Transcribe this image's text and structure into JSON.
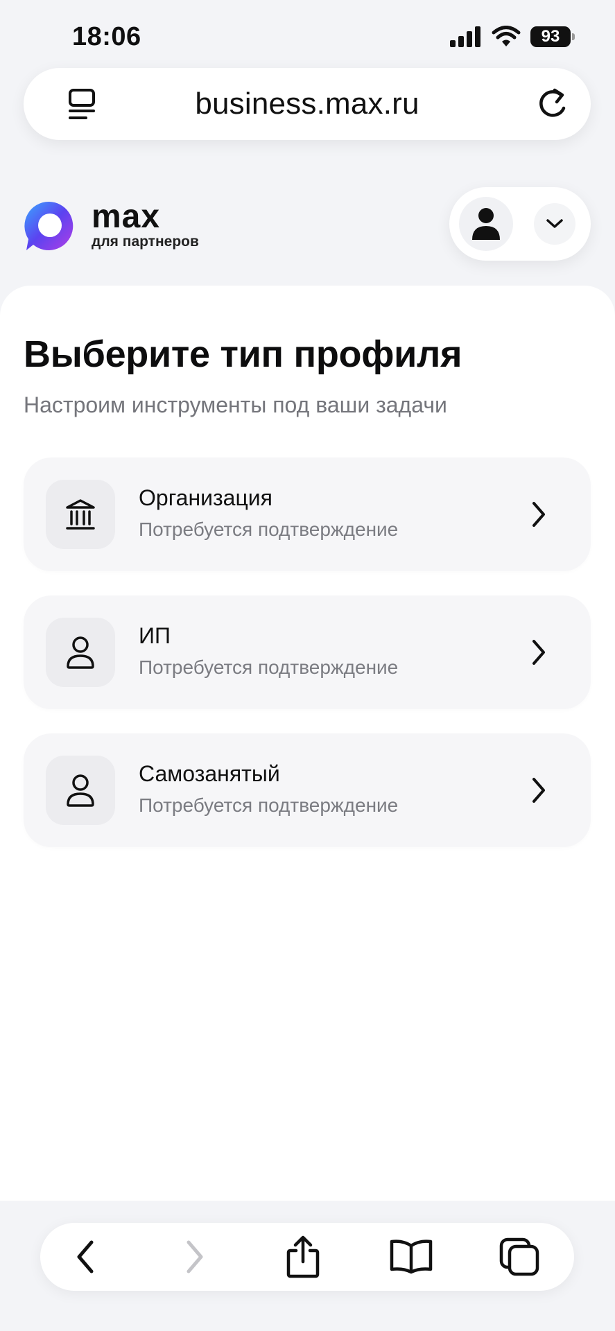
{
  "status_bar": {
    "time": "18:06",
    "battery": "93"
  },
  "browser": {
    "url": "business.max.ru"
  },
  "brand": {
    "name": "max",
    "subtitle": "для партнеров"
  },
  "page": {
    "title": "Выберите тип профиля",
    "subtitle": "Настроим инструменты под ваши задачи"
  },
  "options": [
    {
      "title": "Организация",
      "description": "Потребуется подтверждение",
      "icon": "bank-icon"
    },
    {
      "title": "ИП",
      "description": "Потребуется подтверждение",
      "icon": "person-icon"
    },
    {
      "title": "Самозанятый",
      "description": "Потребуется подтверждение",
      "icon": "person-icon"
    }
  ],
  "colors": {
    "background": "#f3f4f7",
    "card": "#f6f6f8",
    "muted_text": "#74757b",
    "text": "#0f0f10"
  }
}
